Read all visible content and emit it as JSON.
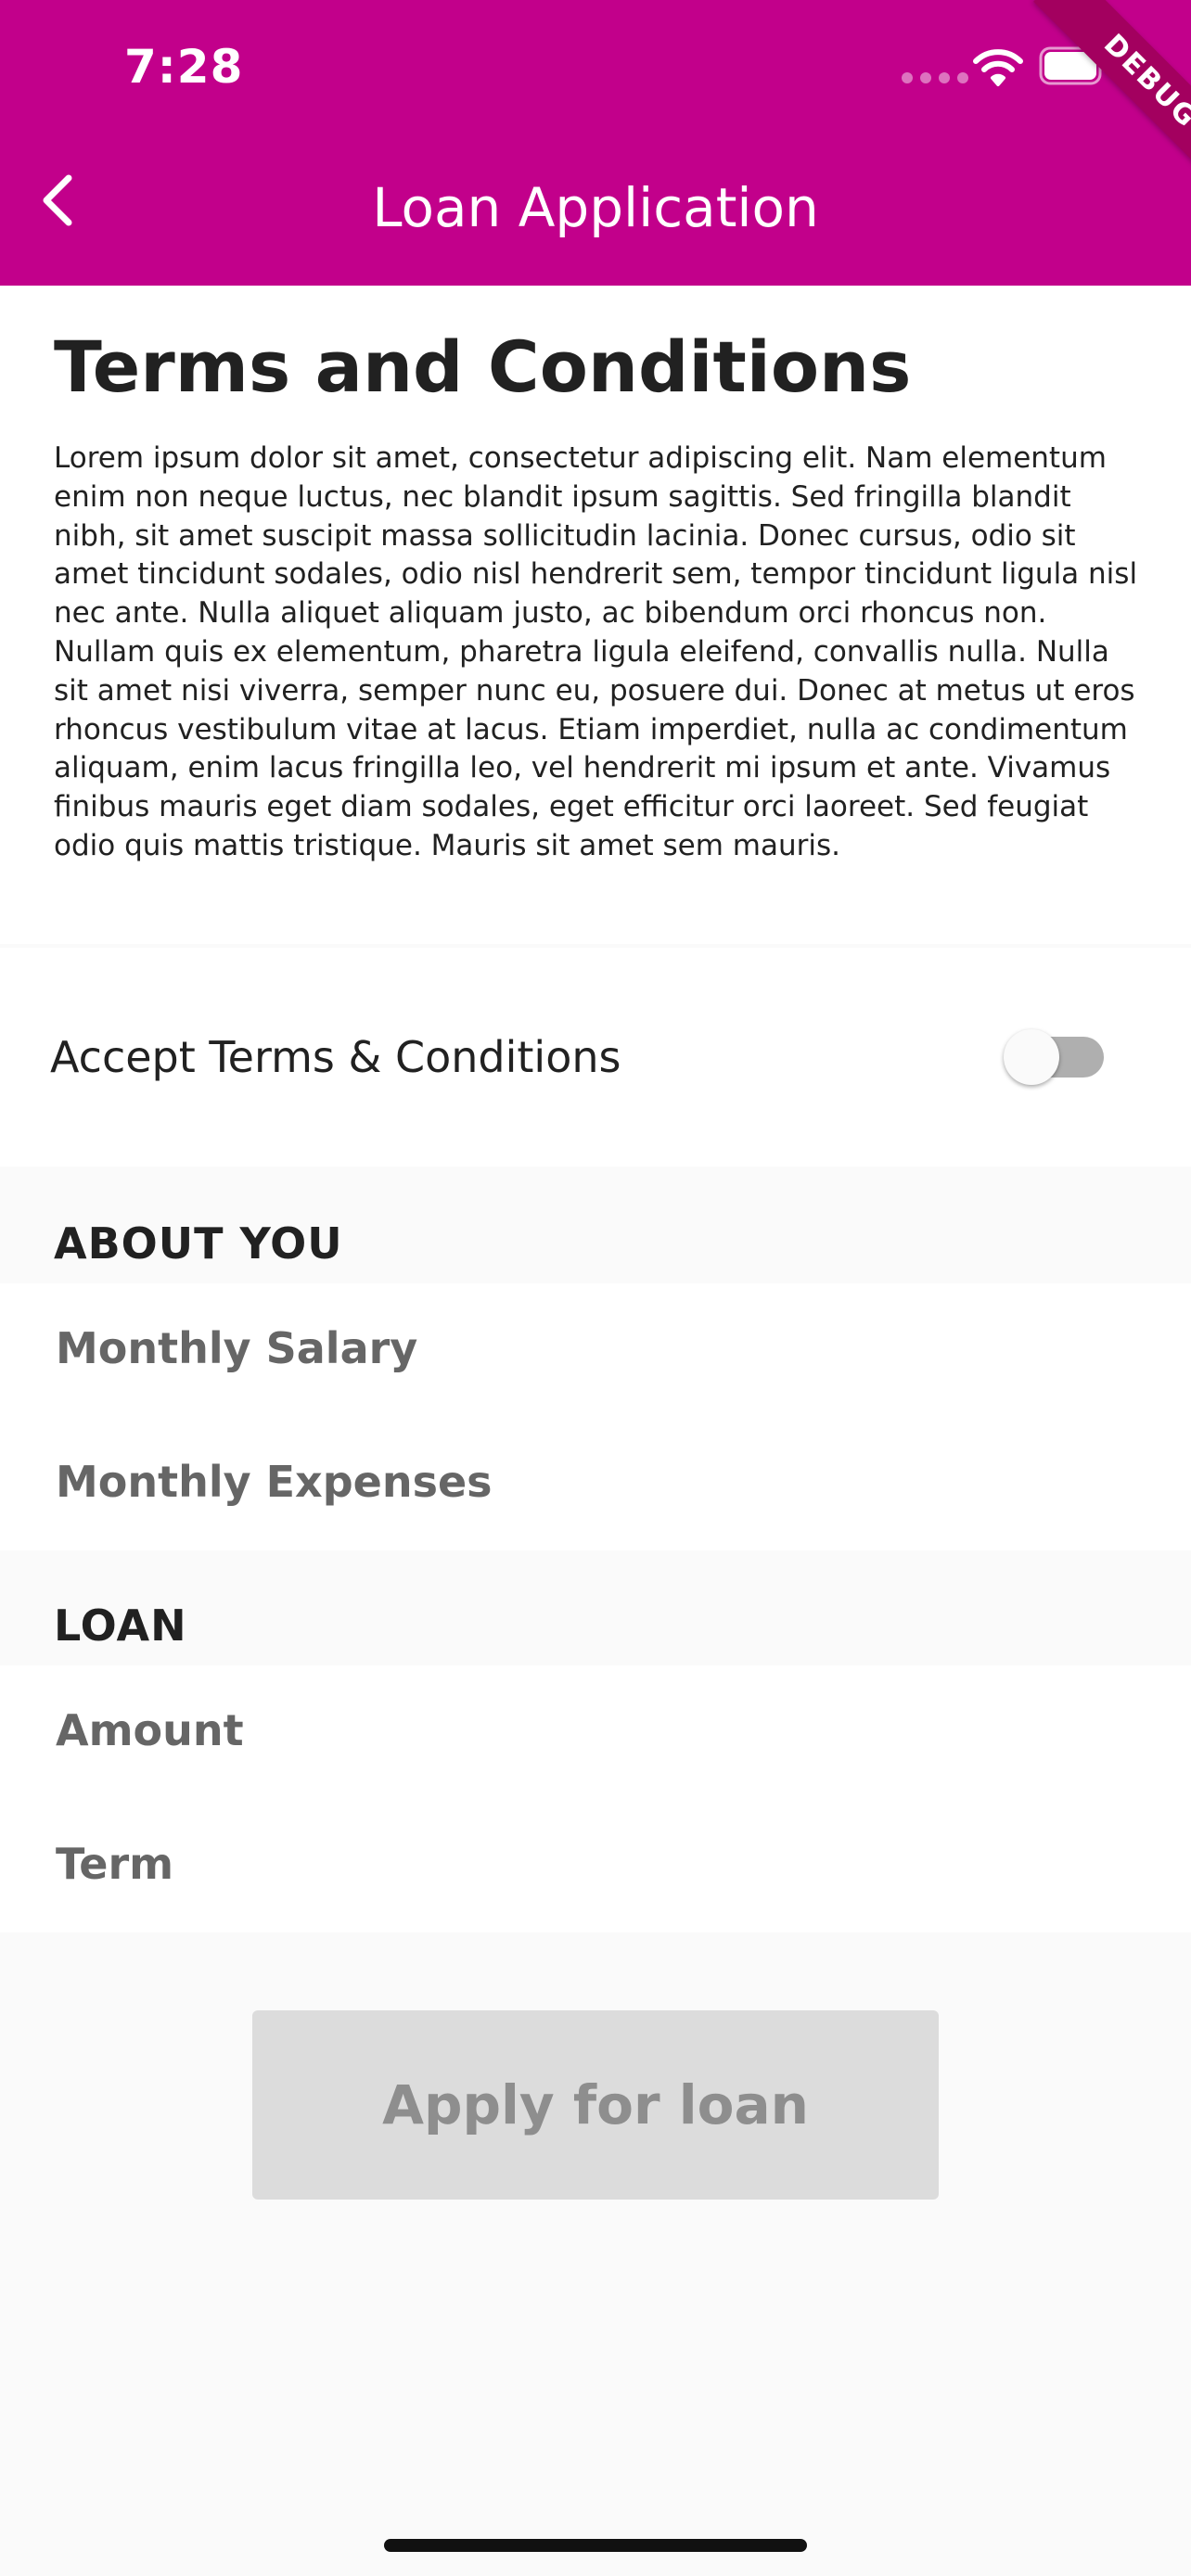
{
  "status_bar": {
    "time": "7:28"
  },
  "debug_banner": "DEBUG",
  "app_bar": {
    "title": "Loan Application",
    "background_color": "#C2008B",
    "back_icon": "chevron-left-icon"
  },
  "terms": {
    "title": "Terms and Conditions",
    "body": "Lorem ipsum dolor sit amet, consectetur adipiscing elit. Nam elementum enim non neque luctus, nec blandit ipsum sagittis. Sed fringilla blandit nibh, sit amet suscipit massa sollicitudin lacinia. Donec cursus, odio sit amet tincidunt sodales, odio nisl hendrerit sem, tempor tincidunt ligula nisl nec ante. Nulla aliquet aliquam justo, ac bibendum orci rhoncus non. Nullam quis ex elementum, pharetra ligula eleifend, convallis nulla. Nulla sit amet nisi viverra, semper nunc eu, posuere dui. Donec at metus ut eros rhoncus vestibulum vitae at lacus. Etiam imperdiet, nulla ac condimentum aliquam, enim lacus fringilla leo, vel hendrerit mi ipsum et ante. Vivamus finibus mauris eget diam sodales, eget efficitur orci laoreet. Sed feugiat odio quis mattis tristique. Mauris sit amet sem mauris."
  },
  "accept": {
    "label": "Accept Terms & Conditions",
    "toggle_on": false
  },
  "about_you": {
    "header": "ABOUT YOU",
    "monthly_salary_placeholder": "Monthly Salary",
    "monthly_expenses_placeholder": "Monthly Expenses"
  },
  "loan": {
    "header": "LOAN",
    "amount_placeholder": "Amount",
    "term_placeholder": "Term"
  },
  "apply_button": {
    "label": "Apply for loan",
    "enabled": false
  }
}
